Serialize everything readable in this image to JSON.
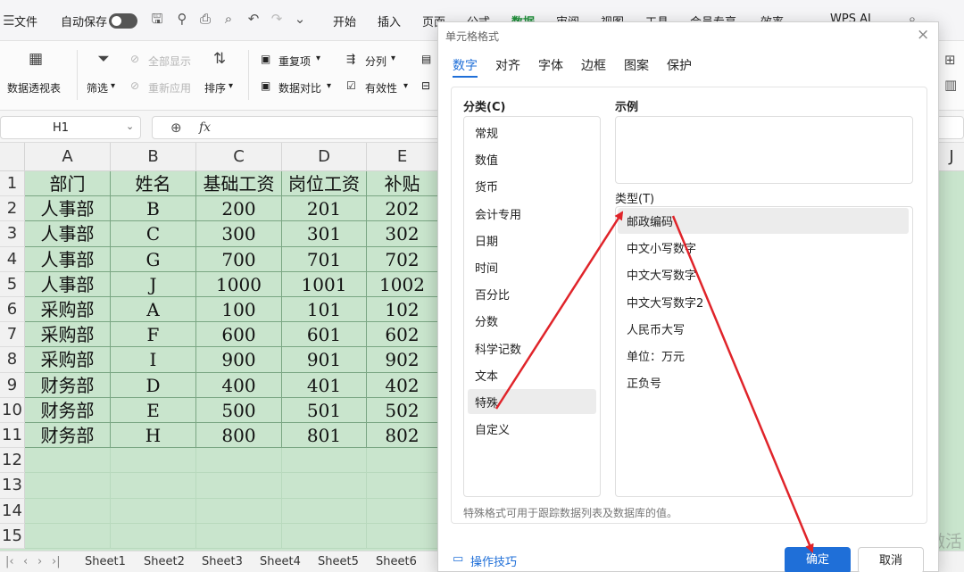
{
  "titlebar": {
    "file": "文件",
    "autosave": "自动保存",
    "menus": [
      "开始",
      "插入",
      "页面",
      "公式",
      "数据",
      "审阅",
      "视图",
      "工具",
      "会员专享",
      "效率"
    ],
    "wps_ai": "WPS AI"
  },
  "ribbon": {
    "pivot": "数据透视表",
    "filter": "筛选",
    "show_all": "全部显示",
    "reapply": "重新应用",
    "sort": "排序",
    "duplicates": "重复项",
    "compare": "数据对比",
    "split": "分列",
    "validity": "有效性"
  },
  "formula_bar": {
    "cell_ref": "H1",
    "fx": "fx"
  },
  "sheet": {
    "columns": [
      "A",
      "B",
      "C",
      "D",
      "E"
    ],
    "hidden_col_j": "J",
    "row_numbers": [
      "1",
      "2",
      "3",
      "4",
      "5",
      "6",
      "7",
      "8",
      "9",
      "10",
      "11",
      "12",
      "13",
      "14",
      "15"
    ],
    "header": [
      "部门",
      "姓名",
      "基础工资",
      "岗位工资",
      "补贴"
    ],
    "rows": [
      [
        "人事部",
        "B",
        "200",
        "201",
        "202"
      ],
      [
        "人事部",
        "C",
        "300",
        "301",
        "302"
      ],
      [
        "人事部",
        "G",
        "700",
        "701",
        "702"
      ],
      [
        "人事部",
        "J",
        "1000",
        "1001",
        "1002"
      ],
      [
        "采购部",
        "A",
        "100",
        "101",
        "102"
      ],
      [
        "采购部",
        "F",
        "600",
        "601",
        "602"
      ],
      [
        "采购部",
        "I",
        "900",
        "901",
        "902"
      ],
      [
        "财务部",
        "D",
        "400",
        "401",
        "402"
      ],
      [
        "财务部",
        "E",
        "500",
        "501",
        "502"
      ],
      [
        "财务部",
        "H",
        "800",
        "801",
        "802"
      ]
    ]
  },
  "tabs": [
    "Sheet1",
    "Sheet2",
    "Sheet3",
    "Sheet4",
    "Sheet5",
    "Sheet6"
  ],
  "dialog": {
    "title": "单元格格式",
    "tabs": [
      "数字",
      "对齐",
      "字体",
      "边框",
      "图案",
      "保护"
    ],
    "category_label": "分类(C)",
    "categories": [
      "常规",
      "数值",
      "货币",
      "会计专用",
      "日期",
      "时间",
      "百分比",
      "分数",
      "科学记数",
      "文本",
      "特殊",
      "自定义"
    ],
    "selected_category": "特殊",
    "sample_label": "示例",
    "type_label": "类型(T)",
    "types": [
      "邮政编码",
      "中文小写数字",
      "中文大写数字",
      "中文大写数字2",
      "人民币大写",
      "单位：万元",
      "正负号"
    ],
    "selected_type": "邮政编码",
    "description": "特殊格式可用于跟踪数据列表及数据库的值。",
    "tips": "操作技巧",
    "ok": "确定",
    "cancel": "取消"
  },
  "watermark": "激活",
  "colors": {
    "accent": "#1f6fd8",
    "grid_fill": "#c9e5cd",
    "arrow": "#e0242a"
  }
}
